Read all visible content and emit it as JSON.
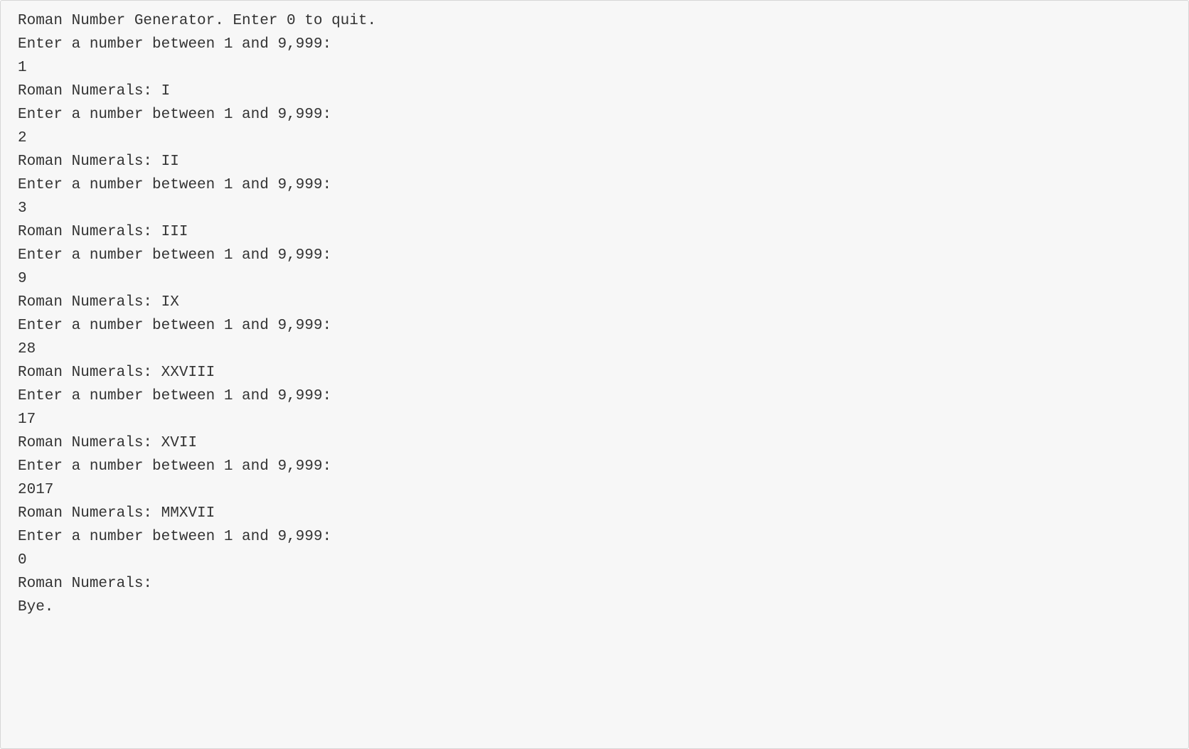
{
  "console": {
    "lines": [
      "Roman Number Generator. Enter 0 to quit.",
      "Enter a number between 1 and 9,999:",
      "1",
      "Roman Numerals: I",
      "Enter a number between 1 and 9,999:",
      "2",
      "Roman Numerals: II",
      "Enter a number between 1 and 9,999:",
      "3",
      "Roman Numerals: III",
      "Enter a number between 1 and 9,999:",
      "9",
      "Roman Numerals: IX",
      "Enter a number between 1 and 9,999:",
      "28",
      "Roman Numerals: XXVIII",
      "Enter a number between 1 and 9,999:",
      "17",
      "Roman Numerals: XVII",
      "Enter a number between 1 and 9,999:",
      "2017",
      "Roman Numerals: MMXVII",
      "Enter a number between 1 and 9,999:",
      "0",
      "Roman Numerals: ",
      "Bye."
    ]
  }
}
